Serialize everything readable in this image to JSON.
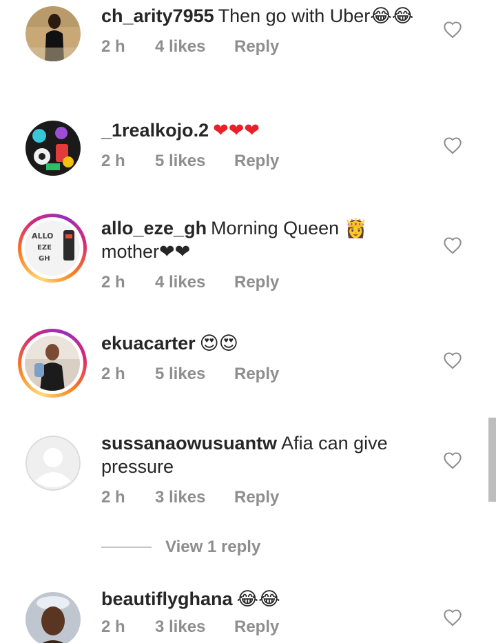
{
  "comments": [
    {
      "username": "ch_arity7955",
      "text": "Then go with Uber😂😂",
      "time": "2 h",
      "likes": "4 likes",
      "reply": "Reply",
      "avatar": "person-photo-dark"
    },
    {
      "username": "_1realkojo.2",
      "text": "❤❤❤",
      "time": "2 h",
      "likes": "5 likes",
      "reply": "Reply",
      "avatar": "sticker-collage"
    },
    {
      "username": "allo_eze_gh",
      "text": "Morning Queen 👸 mother❤❤",
      "time": "2 h",
      "likes": "4 likes",
      "reply": "Reply",
      "avatar_text": [
        "ALLO",
        "EZE",
        "GH"
      ],
      "story_ring": true
    },
    {
      "username": "ekuacarter",
      "text": "😍😍",
      "time": "2 h",
      "likes": "5 likes",
      "reply": "Reply",
      "avatar": "person-photo",
      "story_ring": true
    },
    {
      "username": "sussanaowusuantw",
      "text": "Afia can give pressure",
      "time": "2 h",
      "likes": "3 likes",
      "reply": "Reply",
      "avatar": "default-avatar"
    },
    {
      "username": "beautiflyghana",
      "text": "😂😂",
      "time": "2 h",
      "likes": "3 likes",
      "reply": "Reply",
      "avatar": "person-photo"
    }
  ],
  "view_replies_label": "View 1 reply",
  "icons": {
    "like": "heart-outline-icon"
  },
  "colors": {
    "meta_text": "#8e8e8e",
    "body_text": "#262626",
    "heart_outline": "#8e8e8e",
    "emoji_heart": "#e8202a"
  }
}
